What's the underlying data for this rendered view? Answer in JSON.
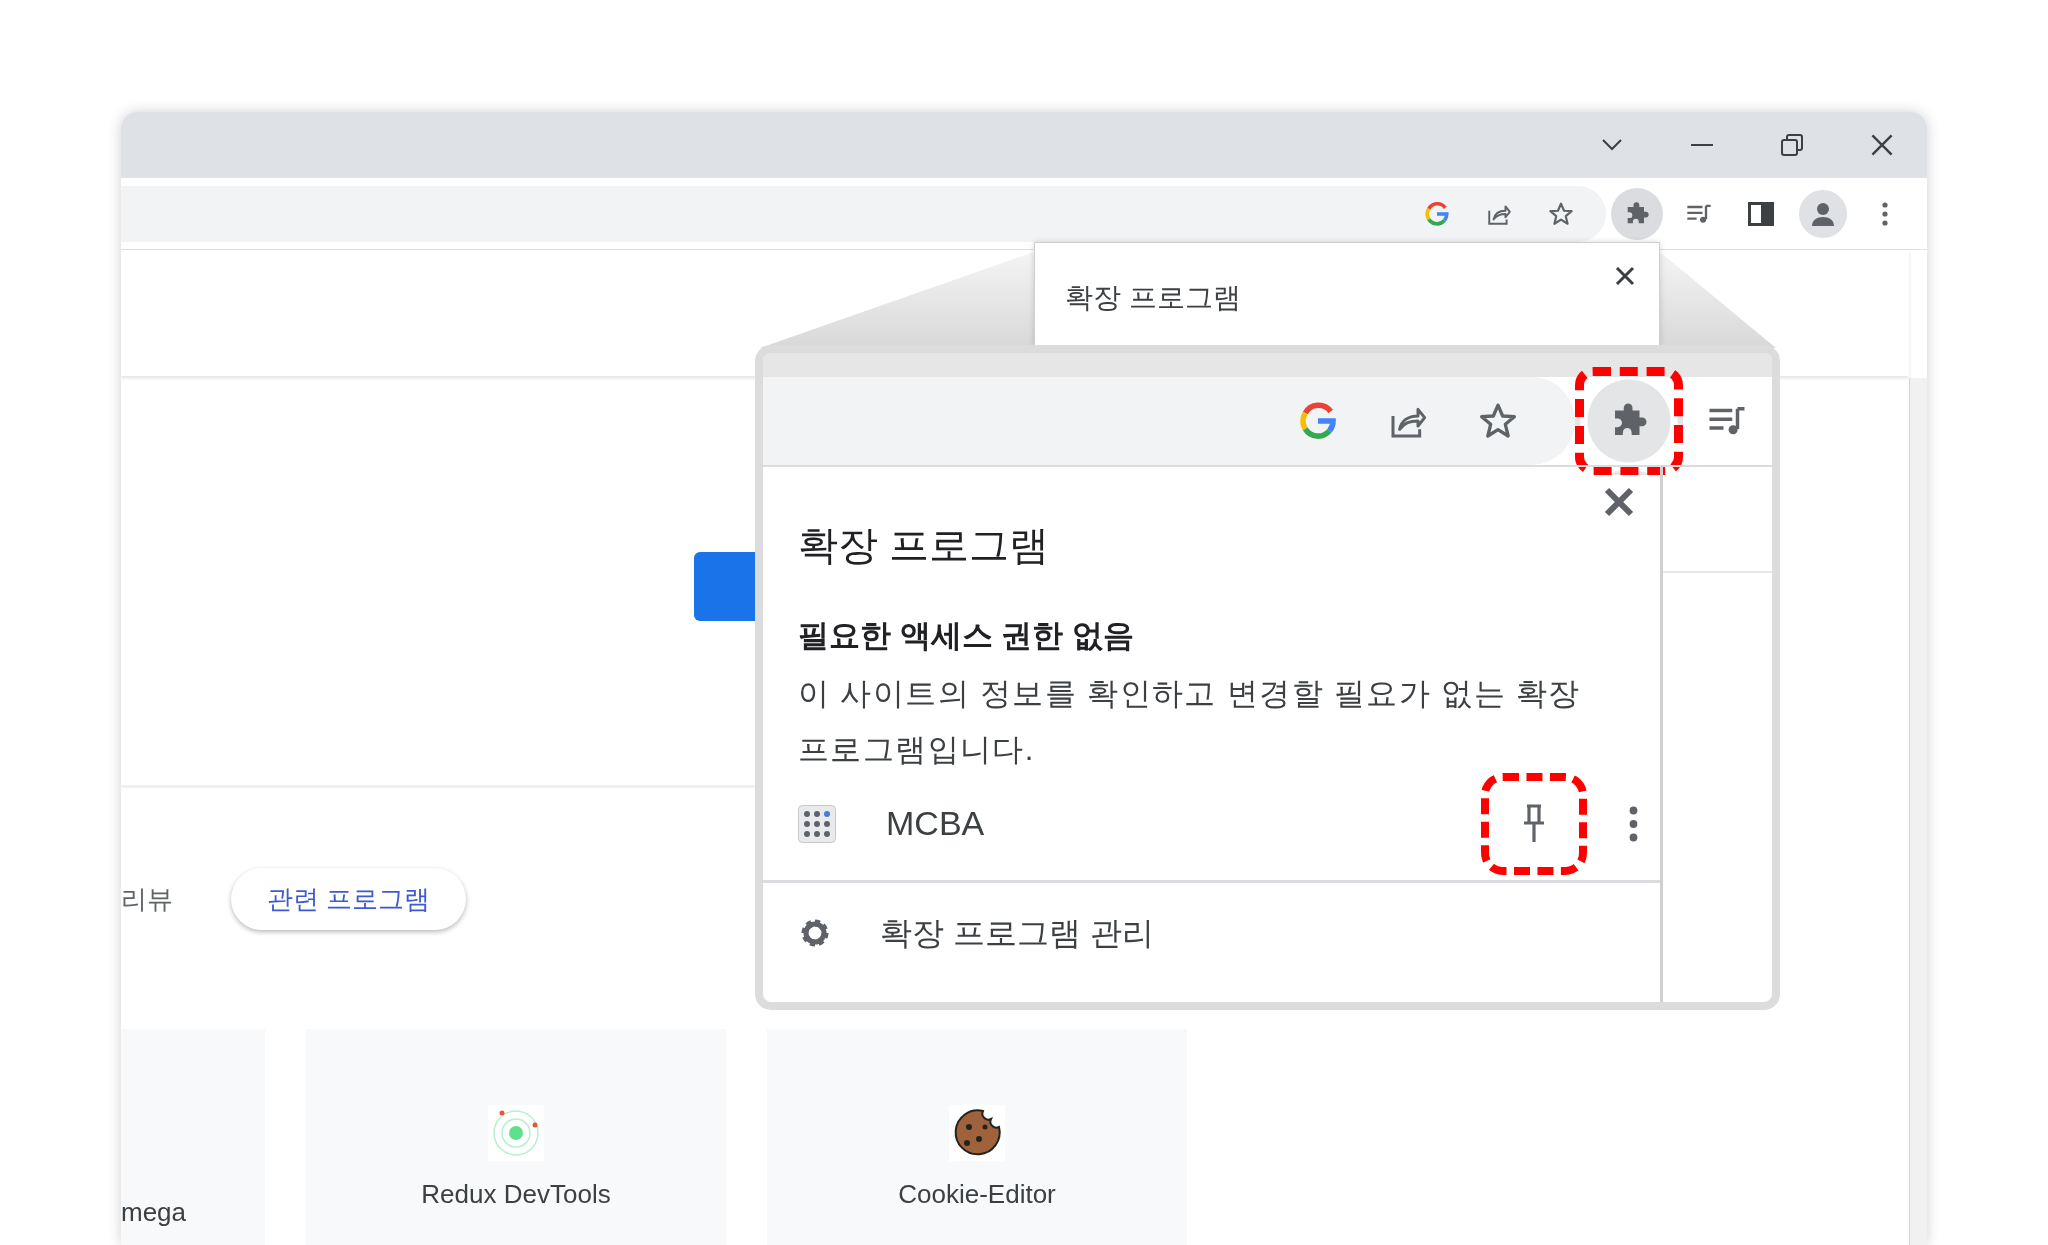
{
  "browser": {
    "toolbar": {
      "extensions_button": {
        "active": true
      }
    }
  },
  "mini_popup": {
    "title": "확장 프로그램"
  },
  "magnified": {
    "toolbar": {
      "extensions_button": {
        "highlighted": true
      }
    },
    "popup": {
      "title": "확장 프로그램",
      "section_heading": "필요한 액세스 권한 없음",
      "section_text": "이 사이트의 정보를 확인하고 변경할 필요가 없는 확장 프로그램입니다.",
      "extensions": [
        {
          "name": "MCBA",
          "pin_highlighted": true
        }
      ],
      "manage_label": "확장 프로그램 관리"
    }
  },
  "page": {
    "tabs": [
      {
        "label": "리뷰",
        "selected": false
      },
      {
        "label": "관련 프로그램",
        "selected": true
      }
    ],
    "cards": [
      {
        "name": "mega"
      },
      {
        "name": "Redux DevTools",
        "kind": "redux"
      },
      {
        "name": "Cookie-Editor",
        "kind": "cookie"
      }
    ]
  }
}
